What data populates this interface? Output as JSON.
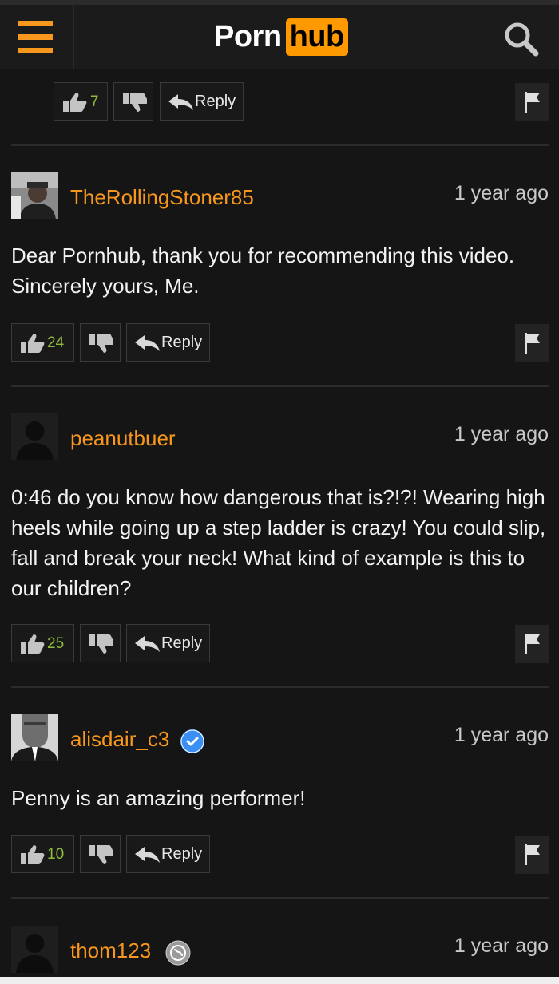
{
  "header": {
    "logo_left": "Porn",
    "logo_right": "hub"
  },
  "top_actions": {
    "likes": "7",
    "reply_label": "Reply"
  },
  "comments": [
    {
      "username": "TheRollingStoner85",
      "time": "1 year ago",
      "text": "Dear Pornhub, thank you for recommending this video. Sincerely yours, Me.",
      "likes": "24",
      "reply_label": "Reply"
    },
    {
      "username": "peanutbuer",
      "time": "1 year ago",
      "text": "0:46 do you know how dangerous that is?!?! Wearing high heels while going up a step ladder is crazy! You could slip, fall and break your neck! What kind of example is this to our children?",
      "likes": "25",
      "reply_label": "Reply"
    },
    {
      "username": "alisdair_c3",
      "time": "1 year ago",
      "text": "Penny is an amazing performer!",
      "likes": "10",
      "reply_label": "Reply",
      "verified": true
    },
    {
      "username": "thom123",
      "time": "1 year ago"
    }
  ],
  "colors": {
    "accent": "#f7971d",
    "background": "#151515",
    "like_count": "#8fbc3a"
  },
  "icons": [
    "menu-icon",
    "search-icon",
    "thumbs-up-icon",
    "thumbs-down-icon",
    "reply-arrow-icon",
    "flag-icon",
    "verified-badge-icon",
    "globe-badge-icon"
  ]
}
